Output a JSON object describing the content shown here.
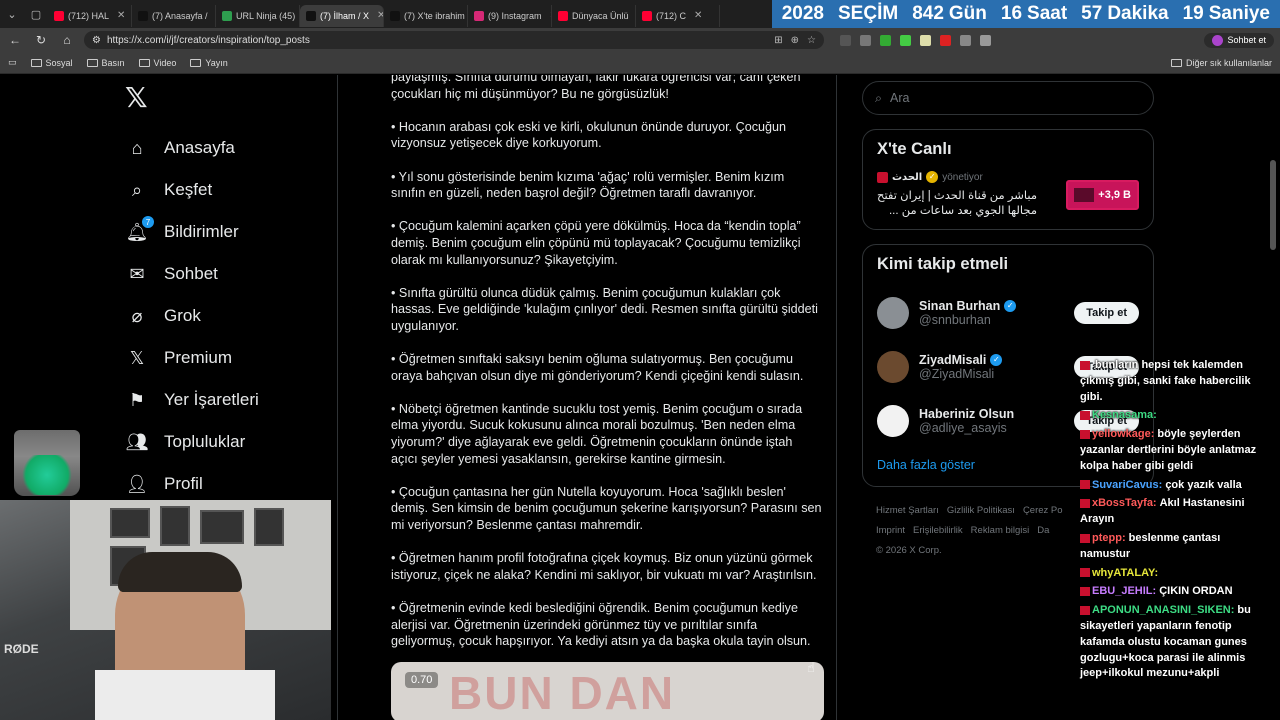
{
  "browser": {
    "tabs": [
      {
        "label": "(712) HAL",
        "color": "#ff0033"
      },
      {
        "label": "(7) Anasayfa /",
        "color": "#111"
      },
      {
        "label": "URL Ninja (45)",
        "color": "#2e9e4f"
      },
      {
        "label": "(7) İlham / X",
        "color": "#111",
        "active": true
      },
      {
        "label": "(7) X'te ibrahim",
        "color": "#111"
      },
      {
        "label": "(9) Instagram",
        "color": "#d62976"
      },
      {
        "label": "Dünyaca Ünlü",
        "color": "#ff0033"
      },
      {
        "label": "(712) C",
        "color": "#ff0033"
      }
    ],
    "countdown": {
      "year": "2028",
      "event": "SEÇİM",
      "days": "842",
      "days_label": "Gün",
      "hours": "16",
      "hours_label": "Saat",
      "minutes": "57",
      "minutes_label": "Dakika",
      "seconds": "19",
      "seconds_label": "Saniye"
    },
    "url": "https://x.com/i/jf/creators/inspiration/top_posts",
    "profile_label": "Sohbet et",
    "bookmarks": [
      "Sosyal",
      "Basın",
      "Video",
      "Yayın"
    ],
    "bookmarks_right": "Diğer sık kullanılanlar"
  },
  "sidebar": {
    "items": [
      {
        "label": "Anasayfa",
        "icon": "home-icon"
      },
      {
        "label": "Keşfet",
        "icon": "search-icon"
      },
      {
        "label": "Bildirimler",
        "icon": "bell-icon",
        "badge": "7"
      },
      {
        "label": "Sohbet",
        "icon": "mail-icon"
      },
      {
        "label": "Grok",
        "icon": "grok-icon"
      },
      {
        "label": "Premium",
        "icon": "x-icon"
      },
      {
        "label": "Yer İşaretleri",
        "icon": "bookmark-icon"
      },
      {
        "label": "Topluluklar",
        "icon": "people-icon"
      },
      {
        "label": "Profil",
        "icon": "person-icon"
      }
    ]
  },
  "feed": {
    "paragraphs": [
      "paylaşmış. Sınıfta durumu olmayan, fakir fukara öğrencisi var; canı çeken çocukları hiç mi düşünmüyor? Bu ne görgüsüzlük!",
      "• Hocanın arabası çok eski ve kirli, okulunun önünde duruyor. Çocuğun vizyonsuz yetişecek diye korkuyorum.",
      "• Yıl sonu gösterisinde benim kızıma 'ağaç' rolü vermişler. Benim kızım sınıfın en güzeli, neden başrol değil? Öğretmen taraflı davranıyor.",
      "• Çocuğum kalemini açarken çöpü yere dökülmüş. Hoca da “kendin topla” demiş. Benim çocuğum elin çöpünü mü toplayacak? Çocuğumu temizlikçi olarak mı kullanıyorsunuz? Şikayetçiyim.",
      "• Sınıfta gürültü olunca düdük çalmış. Benim çocuğumun kulakları çok hassas. Eve geldiğinde 'kulağım çınlıyor' dedi. Resmen sınıfta gürültü şiddeti uygulanıyor.",
      "• Öğretmen sınıftaki saksıyı benim oğluma sulatıyormuş. Ben çocuğumu oraya bahçıvan olsun diye mi gönderiyorum? Kendi çiçeğini kendi sulasın.",
      "• Nöbetçi öğretmen kantinde sucuklu tost yemiş. Benim çocuğum o sırada elma yiyordu. Sucuk kokusunu alınca morali bozulmuş. 'Ben neden elma yiyorum?' diye ağlayarak eve geldi. Öğretmenin çocukların önünde iştah açıcı şeyler yemesi yasaklansın, gerekirse kantine girmesin.",
      "• Çocuğun çantasına her gün Nutella koyuyorum. Hoca 'sağlıklı beslen' demiş. Sen kimsin de benim çocuğumun şekerine karışıyorsun? Parasını sen mi veriyorsun? Beslenme çantası mahremdir.",
      "• Öğretmen hanım profil fotoğrafına çiçek koymuş. Biz onun yüzünü görmek istiyoruz, çiçek ne alaka? Kendini mi saklıyor, bir vukuatı mı var? Araştırılsın.",
      "• Öğretmenin evinde kedi beslediğini öğrendik. Benim çocuğumun kediye alerjisi var. Öğretmenin üzerindeki görünmez tüy ve pırıltılar sınıfa geliyormuş, çocuk hapşırıyor. Ya kediyi atsın ya da başka okula tayin olsun."
    ],
    "video_time": "0.70",
    "video_text": "BUN DAN"
  },
  "right": {
    "search_placeholder": "Ara",
    "live": {
      "title": "X'te Canlı",
      "host": "الحدث",
      "host_role": "yönetiyor",
      "stream_title": "مباشر من قناة الحدث | إيران تفتح مجالها الجوي بعد ساعات من ...",
      "viewers": "+3,9 B"
    },
    "who_to_follow": {
      "title": "Kimi takip etmeli",
      "users": [
        {
          "name": "Sinan Burhan",
          "handle": "@snnburhan",
          "verified": true,
          "avatar_color": "#8a8f94"
        },
        {
          "name": "ZiyadMisali",
          "handle": "@ZiyadMisali",
          "verified": true,
          "avatar_color": "#6b4a2f"
        },
        {
          "name": "Haberiniz Olsun",
          "handle": "@adliye_asayis",
          "verified": false,
          "avatar_color": "#f2f2f2"
        }
      ],
      "follow_label": "Takip et",
      "show_more": "Daha fazla göster"
    },
    "footer": {
      "row1": [
        "Hizmet Şartları",
        "Gizlilik Politikası",
        "Çerez Po"
      ],
      "row2": [
        "Imprint",
        "Erişilebilirlik",
        "Reklam bilgisi",
        "Da"
      ],
      "copyright": "© 2026 X Corp."
    }
  },
  "chat": [
    {
      "user": "",
      "text": "bunların hepsi tek kalemden çıkmış gibi, sanki fake habercilik gibi.",
      "color": "#ff5a5a"
    },
    {
      "user": "Kesnasama:",
      "text": "",
      "color": "#3ddc84"
    },
    {
      "user": "yellowkage:",
      "text": "böyle şeylerden yazanlar dertlerini böyle anlatmaz kolpa haber gibi geldi",
      "color": "#ff5a5a"
    },
    {
      "user": "SuvariCavus:",
      "text": "çok yazık valla",
      "color": "#4aa3ff"
    },
    {
      "user": "xBossTayfa:",
      "text": "Akıl Hastanesini Arayın",
      "color": "#ff5a5a"
    },
    {
      "user": "ptepp:",
      "text": "beslenme çantası namustur",
      "color": "#ff5a5a"
    },
    {
      "user": "whyATALAY:",
      "text": "",
      "color": "#e6e63a"
    },
    {
      "user": "EBU_JEHIL:",
      "text": "ÇIKIN ORDAN",
      "color": "#c77dff"
    },
    {
      "user": "APONUN_ANASINI_SIKEN:",
      "text": "bu sikayetleri yapanların fenotip kafamda olustu kocaman gunes gozlugu+koca parasi ile alinmis jeep+ilkokul mezunu+akpli",
      "color": "#3ddc84"
    }
  ],
  "webcam": {
    "mic_label": "RØDE"
  }
}
